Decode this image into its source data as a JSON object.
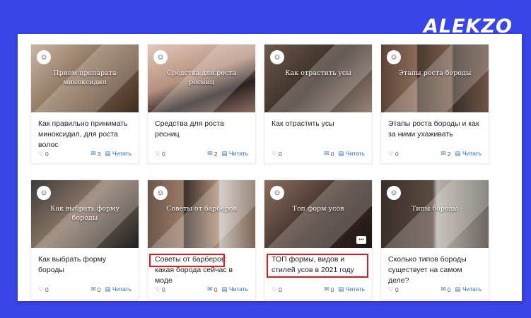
{
  "brand": {
    "logo": "ALEKZO"
  },
  "cards": [
    {
      "title": "Как правильно принимать миноксидил, для роста волос",
      "overlay": "Прием препарата миноксидил",
      "likes": "0",
      "comments": "3",
      "read": "Читать",
      "bg": "linear-gradient(135deg,#c9b7a4,#7a5d45 60%,#3d2c22)"
    },
    {
      "title": "Средства для роста ресниц",
      "overlay": "Средства для роста ресниц",
      "likes": "0",
      "comments": "2",
      "read": "Читать",
      "bg": "linear-gradient(160deg,#e3c8b8,#b6917f 45%,#2a2220 70%,#8e6e63)"
    },
    {
      "title": "Как отрастить усы",
      "overlay": "Как отрастить усы",
      "likes": "0",
      "comments": "0",
      "read": "Читать",
      "bg": "linear-gradient(135deg,#6b5a4c,#3a2d25 50%,#9a8577)"
    },
    {
      "title": "Этапы роста бороды и как за ними ухаживать",
      "overlay": "Этапы роста бороды",
      "likes": "0",
      "comments": "2",
      "read": "Читать",
      "bg": "linear-gradient(90deg,#5d4438 0%,#8a6b58 33%,#4a3a30 34%,#7b5e4c 66%,#3b2e27 67%,#6e5445 100%)"
    },
    {
      "title": "Как выбрать форму бороды",
      "overlay": "Как выбрать форму бороды",
      "likes": "0",
      "comments": "0",
      "read": "Читать",
      "bg": "linear-gradient(135deg,#3c3c3c,#8b7565 45%,#1f1f1f)"
    },
    {
      "title": "Советы от барберов: какая борода сейчас в моде",
      "overlay": "Советы от барберов",
      "likes": "0",
      "comments": "0",
      "read": "Читать",
      "bg": "linear-gradient(90deg,#6c564a 0%,#9b7a66 33%,#3a302a 34%,#b08d76 66%,#c9c2bb 67%,#7f6655 100%)"
    },
    {
      "title": "ТОП формы, видов и стилей усов в 2021 году",
      "overlay": "Топ форм усов",
      "likes": "0",
      "comments": "0",
      "read": "Читать",
      "bg": "linear-gradient(135deg,#8a6e5e,#3b2b24 55%,#1c1512)"
    },
    {
      "title": "Сколько типов бороды существует на самом деле?",
      "overlay": "Типы бороды",
      "likes": "0",
      "comments": "0",
      "read": "Читать",
      "bg": "linear-gradient(90deg,#3a2f2a 0%,#5b4a40 48%,#b9b2ab 52%,#6b6660 100%)"
    }
  ]
}
